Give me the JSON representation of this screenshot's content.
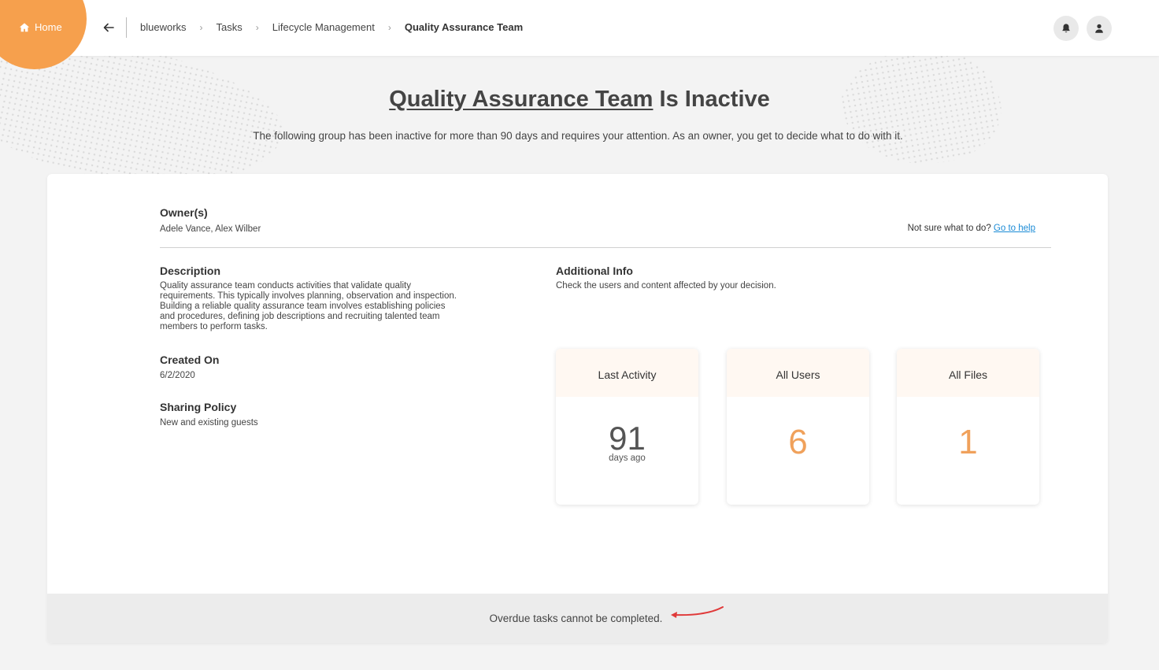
{
  "header": {
    "home_label": "Home",
    "breadcrumbs": [
      "blueworks",
      "Tasks",
      "Lifecycle Management",
      "Quality Assurance Team"
    ]
  },
  "title": {
    "group_link": "Quality Assurance Team",
    "suffix": " Is Inactive",
    "subtitle": "The following group has been inactive for more than 90 days and requires your attention. As an owner, you get to decide what to do with it."
  },
  "details": {
    "owners_label": "Owner(s)",
    "owners_value": "Adele Vance, Alex Wilber",
    "help_prefix": "Not sure what to do? ",
    "help_link": "Go to help",
    "description_label": "Description",
    "description_lines": [
      "Quality assurance team conducts activities that validate quality",
      "requirements. This typically involves planning, observation and inspection.",
      "Building a reliable quality assurance team involves establishing policies",
      "and procedures, defining job descriptions and recruiting talented team",
      "members to perform tasks."
    ],
    "created_label": "Created On",
    "created_value": "6/2/2020",
    "sharing_label": "Sharing Policy",
    "sharing_value": "New and existing guests",
    "additional_label": "Additional Info",
    "additional_value": "Check the users and content affected by your decision."
  },
  "stats": {
    "last_activity": {
      "title": "Last Activity",
      "value": "91",
      "sub": "days ago"
    },
    "all_users": {
      "title": "All Users",
      "value": "6"
    },
    "all_files": {
      "title": "All Files",
      "value": "1"
    }
  },
  "footer": {
    "text": "Overdue tasks cannot be completed."
  },
  "colors": {
    "accent": "#f6a04d",
    "stat_orange": "#f0a15b",
    "link_blue": "#1a8bd6",
    "annotation_red": "#e03a3a"
  },
  "icons": [
    "home-icon",
    "back-arrow-icon",
    "chevron-right-icon",
    "bell-icon",
    "user-icon"
  ]
}
